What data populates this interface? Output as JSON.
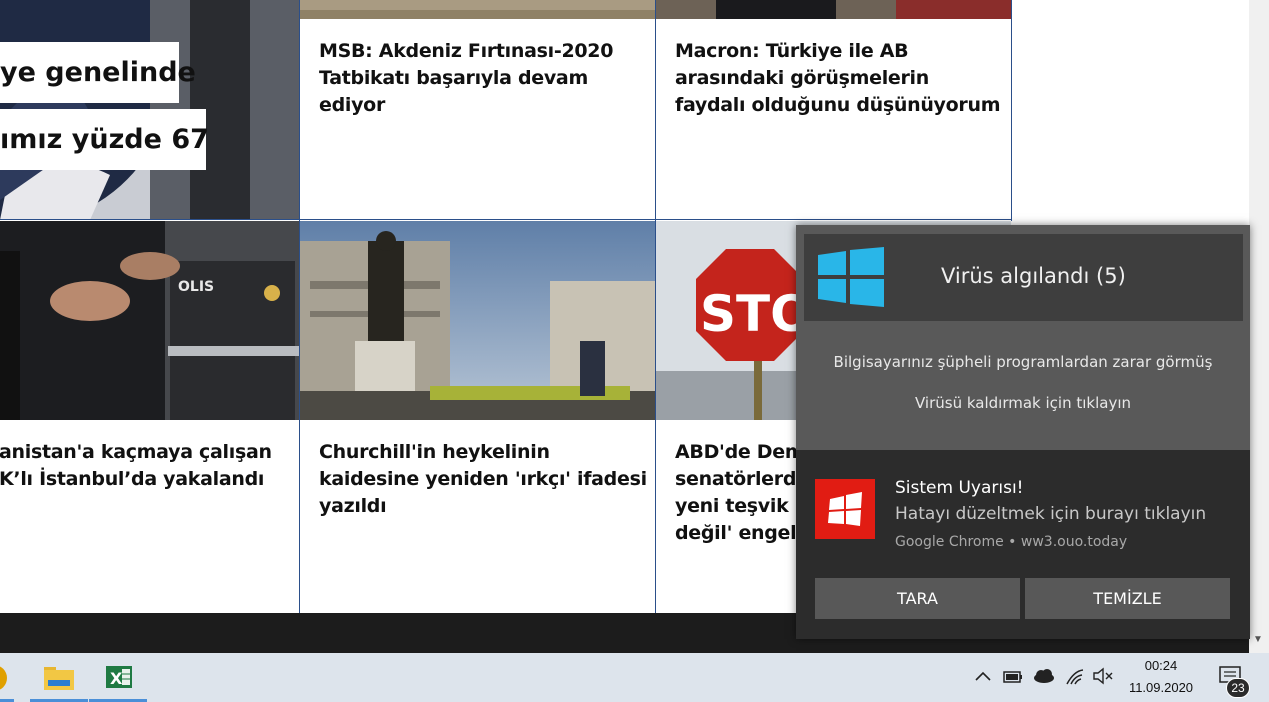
{
  "articles": {
    "hero_line1": "ye genelinde",
    "hero_line2": "ımız yüzde 67",
    "top_mid": "MSB: Akdeniz Fırtınası-2020 Tatbikatı başarıyla devam ediyor",
    "top_right": "Macron: Türkiye ile AB arasındaki görüşmelerin faydalı olduğunu düşünüyorum",
    "bottom_left_1": "anistan'a kaçmaya çalışan",
    "bottom_left_2": "K’lı İstanbul’da yakalandı",
    "bottom_mid": "Churchill'in heykelinin kaidesine yeniden 'ırkçı' ifadesi yazıldı",
    "bottom_right_1": "ABD'de Dem",
    "bottom_right_2": "senatörlerde",
    "bottom_right_3": "yeni teşvik p",
    "bottom_right_4": "değil' engeli",
    "police_badge": "OLIS",
    "stop_sign": "STO"
  },
  "popup": {
    "title": "Virüs algılandı (5)",
    "line1": "Bilgisayarınız şüpheli programlardan zarar görmüş",
    "line2": "Virüsü kaldırmak için tıklayın",
    "notif_title": "Sistem Uyarısı!",
    "notif_sub": "Hatayı düzeltmek için burayı tıklayın",
    "notif_source": "Google Chrome • ww3.ouo.today",
    "btn_scan": "TARA",
    "btn_clean": "TEMİZLE"
  },
  "taskbar": {
    "time": "00:24",
    "date": "11.09.2020",
    "notification_count": "23",
    "excel_letter": "X"
  },
  "colors": {
    "windows_logo": "#29b6e8",
    "alert_red": "#e11c13",
    "grid_line": "#2b4f8a"
  }
}
